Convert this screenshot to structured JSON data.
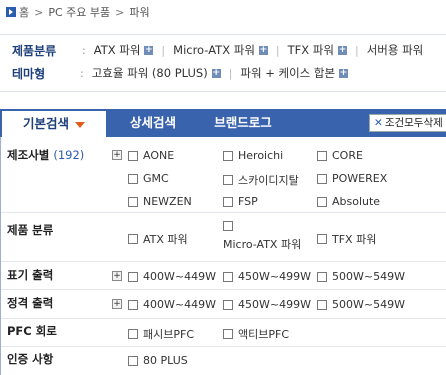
{
  "breadcrumb": {
    "home": "홈",
    "items": [
      "PC 주요 부품",
      "파워"
    ]
  },
  "categories": {
    "product_label": "제품분류",
    "product_items": [
      "ATX 파워",
      "Micro-ATX 파워",
      "TFX 파워",
      "서버용 파워"
    ],
    "theme_label": "테마형",
    "theme_items": [
      "고효율 파워 (80 PLUS)",
      "파워 + 케이스 합본"
    ]
  },
  "tabs": {
    "basic": "기본검색",
    "detail": "상세검색",
    "brand": "브랜드로그",
    "reset": "조건모두삭제"
  },
  "filters": {
    "maker": {
      "label": "제조사별",
      "count": "(192)",
      "options": [
        "AONE",
        "Heroichi",
        "CORE",
        "GMC",
        "스카이디지탈",
        "POWEREX",
        "NEWZEN",
        "FSP",
        "Absolute"
      ]
    },
    "type": {
      "label": "제품 분류",
      "options": [
        "ATX 파워",
        "Micro-ATX 파워",
        "TFX 파워"
      ]
    },
    "label_output": {
      "label": "표기 출력",
      "options": [
        "400W~449W",
        "450W~499W",
        "500W~549W"
      ]
    },
    "rated_output": {
      "label": "정격 출력",
      "options": [
        "400W~449W",
        "450W~499W",
        "500W~549W"
      ]
    },
    "pfc": {
      "label": "PFC 회로",
      "options": [
        "패시브PFC",
        "액티브PFC"
      ]
    },
    "cert": {
      "label": "인증 사항",
      "options": [
        "80 PLUS"
      ]
    }
  },
  "colors": {
    "tab_bar": "#3a63ad",
    "accent_arrow": "#e05a1a",
    "title_blue": "#1d3f7a"
  }
}
